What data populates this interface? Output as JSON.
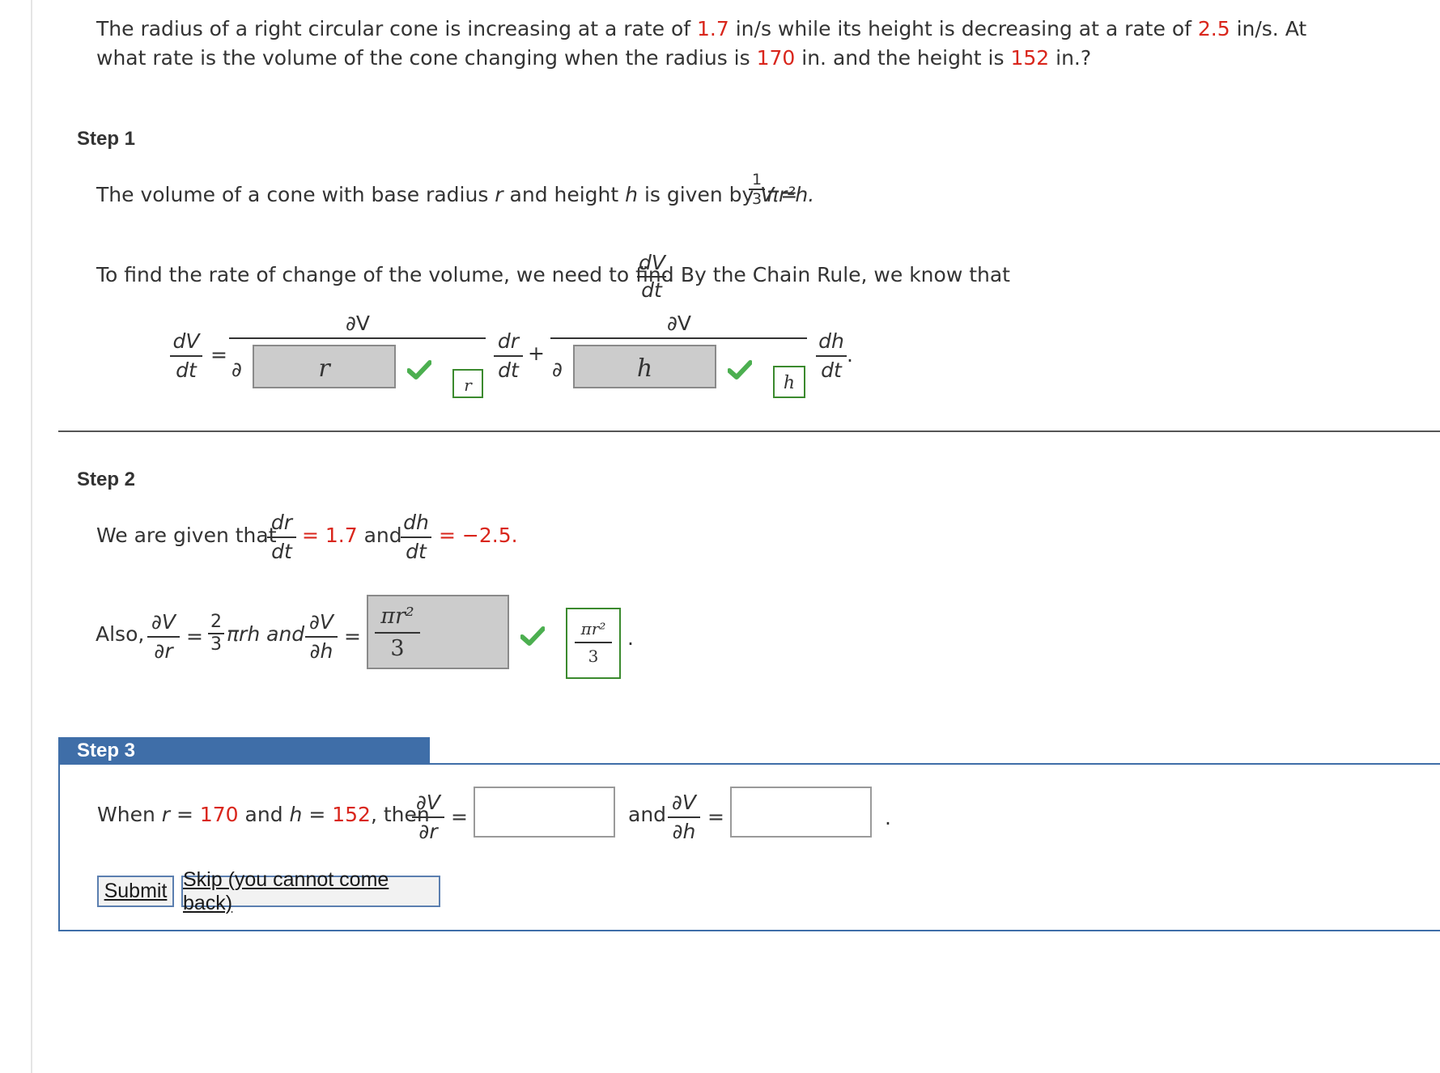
{
  "question": {
    "p1": "The radius of a right circular cone is increasing at a rate of ",
    "v1": "1.7",
    "p2": " in/s while its height is decreasing at a rate of ",
    "v2": "2.5",
    "p3": " in/s. At",
    "p4": "what rate is the volume of the cone changing when the radius is ",
    "v3": "170",
    "p5": " in. and the height is ",
    "v4": "152",
    "p6": " in.?"
  },
  "step1": {
    "heading": "Step 1",
    "volume_text": "The volume of a cone with base radius ",
    "r": "r",
    "and_height": " and height ",
    "h": "h",
    "given_by": " is given by ",
    "V": "V",
    "eq": " = ",
    "one": "1",
    "three": "3",
    "pi_r2h": "πr²h.",
    "rate_text": "To find the rate of change of the volume, we need to find ",
    "dV": "dV",
    "dt": "dt",
    "chain_text": ". By the Chain Rule, we know that",
    "partial": "∂",
    "partialV": "∂V",
    "dr": "dr",
    "dh": "dh",
    "plus": "+",
    "ans_r": "r",
    "fb_r": "r",
    "ans_h": "h",
    "fb_h": "h",
    "period": "."
  },
  "step2": {
    "heading": "Step 2",
    "given": "We are given that ",
    "drdt_val": "= 1.7",
    "and": " and ",
    "dhdt_val": "= −2.5.",
    "also": "Also,",
    "dVdr": "∂V",
    "dr_p": "∂r",
    "two": "2",
    "three": "3",
    "pirh": "πrh and",
    "dVdh": "∂V",
    "dh_p": "∂h",
    "ans_num": "πr²",
    "ans_den": "3",
    "fb_num": "πr²",
    "fb_den": "3",
    "period": "."
  },
  "step3": {
    "heading": "Step 3",
    "when": "When ",
    "r": "r",
    "eq1": " = ",
    "rval": "170",
    "and": " and ",
    "h": "h",
    "hval": "152",
    "then": ", then",
    "dV": "∂V",
    "dr": "∂r",
    "dh": "∂h",
    "and2": "and",
    "period": "."
  },
  "buttons": {
    "submit": "Submit",
    "skip": "Skip (you cannot come back)"
  },
  "colors": {
    "highlight": "#d9261c",
    "step_header_bg": "#3f6ea8",
    "check": "#4caf50"
  }
}
